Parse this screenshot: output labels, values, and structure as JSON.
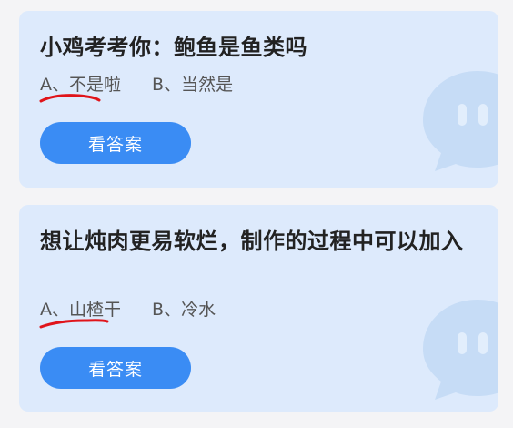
{
  "cards": [
    {
      "question": "小鸡考考你：鲍鱼是鱼类吗",
      "option_a": "A、不是啦",
      "option_b": "B、当然是",
      "button_label": "看答案",
      "marked_option": "A"
    },
    {
      "question": "想让炖肉更易软烂，制作的过程中可以加入",
      "option_a": "A、山楂干",
      "option_b": "B、冷水",
      "button_label": "看答案",
      "marked_option": "A"
    }
  ],
  "colors": {
    "card_background": "#ddeafc",
    "button": "#3a8cf4",
    "mark": "#e0141a"
  },
  "icons": [
    "chat-bubble-icon",
    "chat-bubble-icon"
  ]
}
